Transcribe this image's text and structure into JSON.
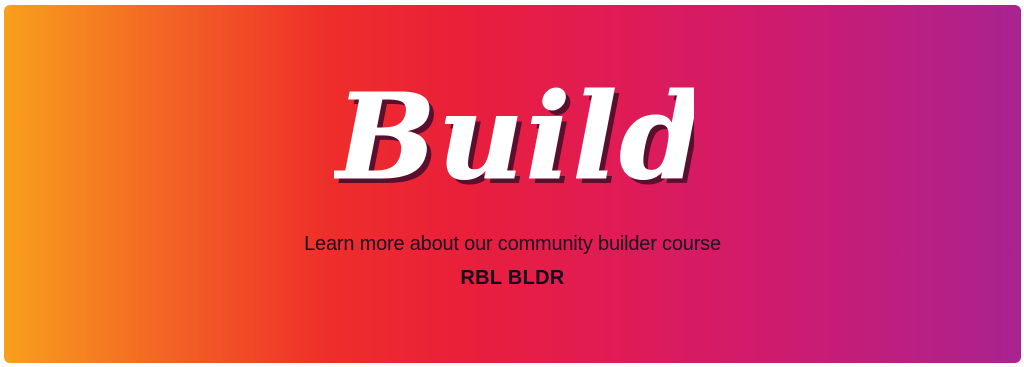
{
  "banner": {
    "title": "Build",
    "subtitle": "Learn more about our community builder course",
    "brand": "RBL BLDR"
  },
  "colors": {
    "gradient_start": "#f8a01c",
    "gradient_mid": "#ee2e2a",
    "gradient_end": "#a92390",
    "title_fill": "#ffffff",
    "title_shadow": "#5a0f2e",
    "text": "#1b0f22"
  }
}
